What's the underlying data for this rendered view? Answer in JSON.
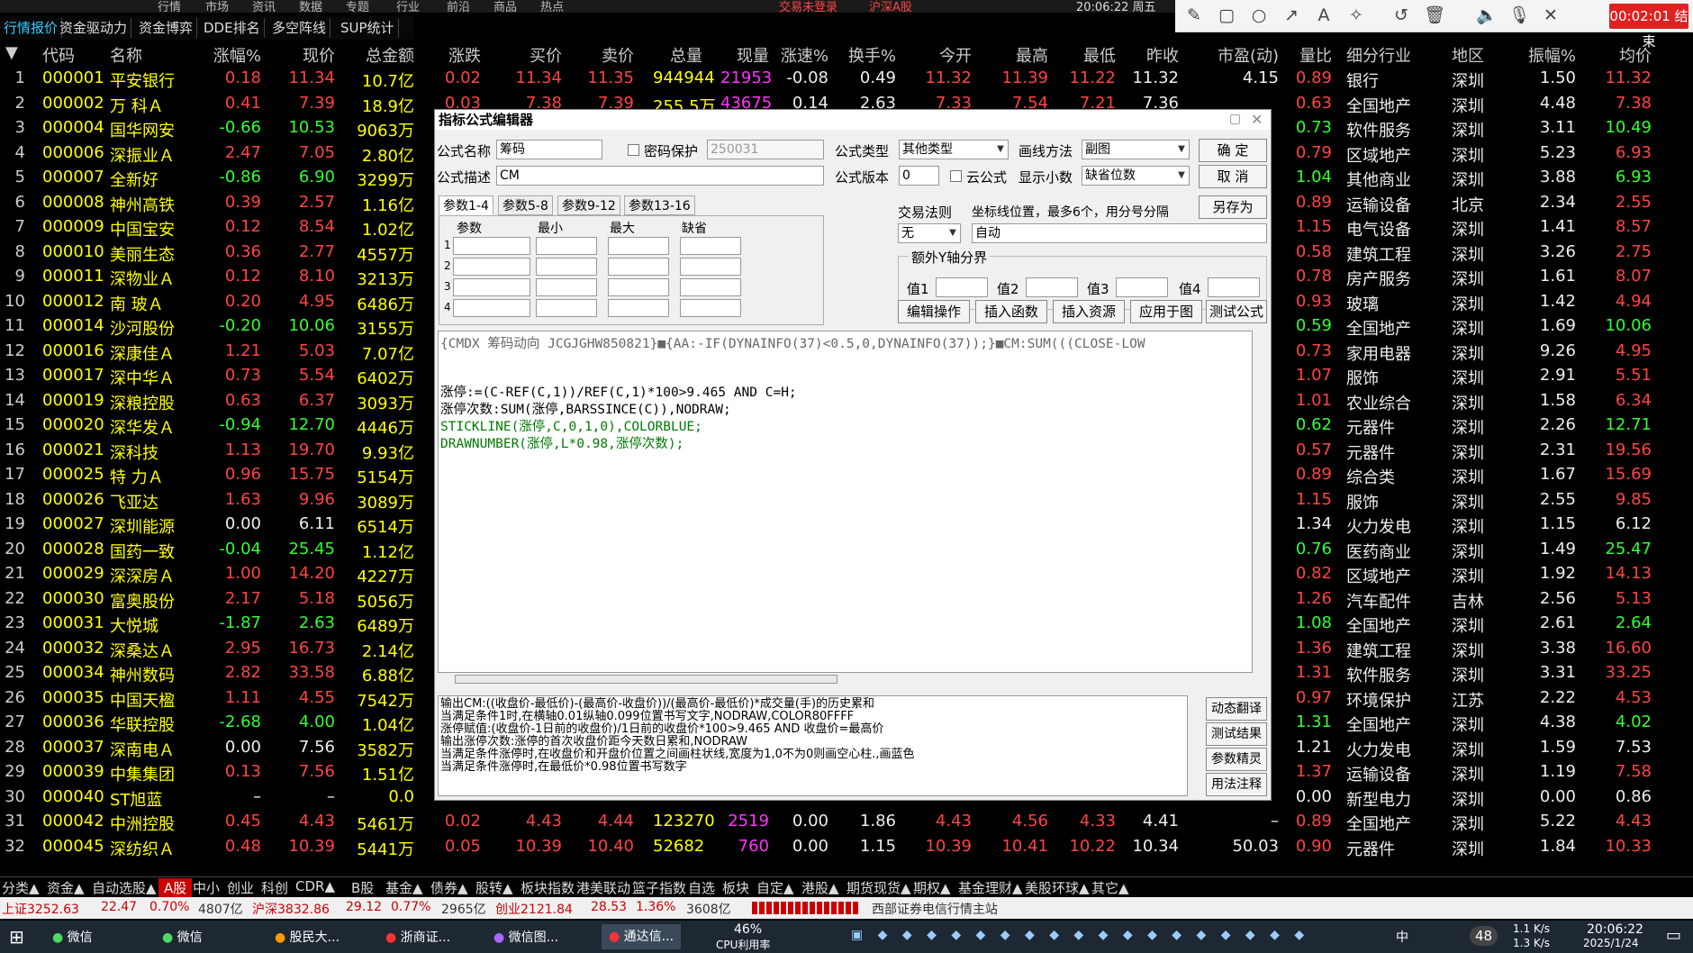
{
  "top_menu": [
    "行情",
    "市场",
    "资讯",
    "数据",
    "专题",
    "行业",
    "前沿",
    "商品",
    "热点"
  ],
  "top_status": {
    "trade": "交易未登录",
    "market": "沪深A股",
    "time": "20:06:22 周五"
  },
  "tabs": [
    "行情报价",
    "资金驱动力",
    "资金博弈",
    "DDE排名",
    "多空阵线",
    "SUP统计"
  ],
  "recording": {
    "timer": "00:02:01 结束"
  },
  "headers": [
    "代码",
    "名称",
    "涨幅%",
    "现价",
    "总金额",
    "涨跌",
    "买价",
    "卖价",
    "总量",
    "现量",
    "涨速%",
    "换手%",
    "今开",
    "最高",
    "最低",
    "昨收",
    "市盈(动)",
    "量比",
    "细分行业",
    "地区",
    "振幅%",
    "均价"
  ],
  "rows": [
    {
      "no": "1",
      "code": "000001",
      "name": "平安银行",
      "chg": "0.18",
      "price": "11.34",
      "amt": "10.7亿",
      "d": "0.02",
      "bid": "11.34",
      "ask": "11.35",
      "vol": "944944",
      "cur": "21953",
      "spd": "-0.08",
      "turn": "0.49",
      "open": "11.32",
      "high": "11.39",
      "low": "11.22",
      "prev": "11.32",
      "pe": "4.15",
      "lb": "0.89",
      "ind": "银行",
      "reg": "深圳",
      "amp": "1.50",
      "avg": "11.32"
    },
    {
      "no": "2",
      "code": "000002",
      "name": "万 科Ａ",
      "chg": "0.41",
      "price": "7.39",
      "amt": "18.9亿",
      "d": "0.03",
      "bid": "7.38",
      "ask": "7.39",
      "vol": "255.5万",
      "cur": "43675",
      "spd": "0.14",
      "turn": "2.63",
      "open": "7.33",
      "high": "7.54",
      "low": "7.21",
      "prev": "7.36",
      "pe": "",
      "lb": "0.63",
      "ind": "全国地产",
      "reg": "深圳",
      "amp": "4.48",
      "avg": "7.38"
    },
    {
      "no": "3",
      "code": "000004",
      "name": "国华网安",
      "chg": "-0.66",
      "price": "10.53",
      "amt": "9063万",
      "lb": "0.73",
      "ind": "软件服务",
      "reg": "深圳",
      "amp": "3.11",
      "avg": "10.49"
    },
    {
      "no": "4",
      "code": "000006",
      "name": "深振业Ａ",
      "chg": "2.47",
      "price": "7.05",
      "amt": "2.80亿",
      "lb": "0.79",
      "ind": "区域地产",
      "reg": "深圳",
      "amp": "5.23",
      "avg": "6.93"
    },
    {
      "no": "5",
      "code": "000007",
      "name": "全新好",
      "chg": "-0.86",
      "price": "6.90",
      "amt": "3299万",
      "lb": "1.04",
      "ind": "其他商业",
      "reg": "深圳",
      "amp": "3.88",
      "avg": "6.93"
    },
    {
      "no": "6",
      "code": "000008",
      "name": "神州高铁",
      "chg": "0.39",
      "price": "2.57",
      "amt": "1.16亿",
      "lb": "0.89",
      "ind": "运输设备",
      "reg": "北京",
      "amp": "2.34",
      "avg": "2.55"
    },
    {
      "no": "7",
      "code": "000009",
      "name": "中国宝安",
      "chg": "0.12",
      "price": "8.54",
      "amt": "1.02亿",
      "lb": "1.15",
      "ind": "电气设备",
      "reg": "深圳",
      "amp": "1.41",
      "avg": "8.57"
    },
    {
      "no": "8",
      "code": "000010",
      "name": "美丽生态",
      "chg": "0.36",
      "price": "2.77",
      "amt": "4557万",
      "lb": "0.58",
      "ind": "建筑工程",
      "reg": "深圳",
      "amp": "3.26",
      "avg": "2.75"
    },
    {
      "no": "9",
      "code": "000011",
      "name": "深物业Ａ",
      "chg": "0.12",
      "price": "8.10",
      "amt": "3213万",
      "lb": "0.78",
      "ind": "房产服务",
      "reg": "深圳",
      "amp": "1.61",
      "avg": "8.07"
    },
    {
      "no": "10",
      "code": "000012",
      "name": "南 玻Ａ",
      "chg": "0.20",
      "price": "4.95",
      "amt": "6486万",
      "lb": "0.93",
      "ind": "玻璃",
      "reg": "深圳",
      "amp": "1.42",
      "avg": "4.94"
    },
    {
      "no": "11",
      "code": "000014",
      "name": "沙河股份",
      "chg": "-0.20",
      "price": "10.06",
      "amt": "3155万",
      "lb": "0.59",
      "ind": "全国地产",
      "reg": "深圳",
      "amp": "1.69",
      "avg": "10.06"
    },
    {
      "no": "12",
      "code": "000016",
      "name": "深康佳Ａ",
      "chg": "1.21",
      "price": "5.03",
      "amt": "7.07亿",
      "lb": "0.73",
      "ind": "家用电器",
      "reg": "深圳",
      "amp": "9.26",
      "avg": "4.95"
    },
    {
      "no": "13",
      "code": "000017",
      "name": "深中华Ａ",
      "chg": "0.73",
      "price": "5.54",
      "amt": "6402万",
      "lb": "1.07",
      "ind": "服饰",
      "reg": "深圳",
      "amp": "2.91",
      "avg": "5.51"
    },
    {
      "no": "14",
      "code": "000019",
      "name": "深粮控股",
      "chg": "0.63",
      "price": "6.37",
      "amt": "3093万",
      "lb": "1.01",
      "ind": "农业综合",
      "reg": "深圳",
      "amp": "1.58",
      "avg": "6.34"
    },
    {
      "no": "15",
      "code": "000020",
      "name": "深华发Ａ",
      "chg": "-0.94",
      "price": "12.70",
      "amt": "4446万",
      "lb": "0.62",
      "ind": "元器件",
      "reg": "深圳",
      "amp": "2.26",
      "avg": "12.71"
    },
    {
      "no": "16",
      "code": "000021",
      "name": "深科技",
      "chg": "1.13",
      "price": "19.70",
      "amt": "9.93亿",
      "lb": "0.57",
      "ind": "元器件",
      "reg": "深圳",
      "amp": "2.31",
      "avg": "19.56"
    },
    {
      "no": "17",
      "code": "000025",
      "name": "特 力Ａ",
      "chg": "0.96",
      "price": "15.75",
      "amt": "5154万",
      "lb": "0.89",
      "ind": "综合类",
      "reg": "深圳",
      "amp": "1.67",
      "avg": "15.69"
    },
    {
      "no": "18",
      "code": "000026",
      "name": "飞亚达",
      "chg": "1.63",
      "price": "9.96",
      "amt": "3089万",
      "lb": "1.15",
      "ind": "服饰",
      "reg": "深圳",
      "amp": "2.55",
      "avg": "9.85"
    },
    {
      "no": "19",
      "code": "000027",
      "name": "深圳能源",
      "chg": "0.00",
      "price": "6.11",
      "amt": "6514万",
      "lb": "1.34",
      "ind": "火力发电",
      "reg": "深圳",
      "amp": "1.15",
      "avg": "6.12"
    },
    {
      "no": "20",
      "code": "000028",
      "name": "国药一致",
      "chg": "-0.04",
      "price": "25.45",
      "amt": "1.12亿",
      "lb": "0.76",
      "ind": "医药商业",
      "reg": "深圳",
      "amp": "1.49",
      "avg": "25.47"
    },
    {
      "no": "21",
      "code": "000029",
      "name": "深深房Ａ",
      "chg": "1.00",
      "price": "14.20",
      "amt": "4227万",
      "lb": "0.82",
      "ind": "区域地产",
      "reg": "深圳",
      "amp": "1.92",
      "avg": "14.13"
    },
    {
      "no": "22",
      "code": "000030",
      "name": "富奥股份",
      "chg": "2.17",
      "price": "5.18",
      "amt": "5056万",
      "lb": "1.26",
      "ind": "汽车配件",
      "reg": "吉林",
      "amp": "2.56",
      "avg": "5.13"
    },
    {
      "no": "23",
      "code": "000031",
      "name": "大悦城",
      "chg": "-1.87",
      "price": "2.63",
      "amt": "6489万",
      "lb": "1.08",
      "ind": "全国地产",
      "reg": "深圳",
      "amp": "2.61",
      "avg": "2.64"
    },
    {
      "no": "24",
      "code": "000032",
      "name": "深桑达Ａ",
      "chg": "2.95",
      "price": "16.73",
      "amt": "2.14亿",
      "lb": "1.36",
      "ind": "建筑工程",
      "reg": "深圳",
      "amp": "3.38",
      "avg": "16.60"
    },
    {
      "no": "25",
      "code": "000034",
      "name": "神州数码",
      "chg": "2.82",
      "price": "33.58",
      "amt": "6.88亿",
      "lb": "1.31",
      "ind": "软件服务",
      "reg": "深圳",
      "amp": "3.31",
      "avg": "33.25"
    },
    {
      "no": "26",
      "code": "000035",
      "name": "中国天楹",
      "chg": "1.11",
      "price": "4.55",
      "amt": "7542万",
      "lb": "0.97",
      "ind": "环境保护",
      "reg": "江苏",
      "amp": "2.22",
      "avg": "4.53"
    },
    {
      "no": "27",
      "code": "000036",
      "name": "华联控股",
      "chg": "-2.68",
      "price": "4.00",
      "amt": "1.04亿",
      "lb": "1.31",
      "ind": "全国地产",
      "reg": "深圳",
      "amp": "4.38",
      "avg": "4.02"
    },
    {
      "no": "28",
      "code": "000037",
      "name": "深南电Ａ",
      "chg": "0.00",
      "price": "7.56",
      "amt": "3582万",
      "lb": "1.21",
      "ind": "火力发电",
      "reg": "深圳",
      "amp": "1.59",
      "avg": "7.53"
    },
    {
      "no": "29",
      "code": "000039",
      "name": "中集集团",
      "chg": "0.13",
      "price": "7.56",
      "amt": "1.51亿",
      "lb": "1.37",
      "ind": "运输设备",
      "reg": "深圳",
      "amp": "1.19",
      "avg": "7.58"
    },
    {
      "no": "30",
      "code": "000040",
      "name": "ST旭蓝",
      "chg": "–",
      "price": "–",
      "amt": "0.0",
      "lb": "0.00",
      "ind": "新型电力",
      "reg": "深圳",
      "amp": "0.00",
      "avg": "0.86"
    },
    {
      "no": "31",
      "code": "000042",
      "name": "中洲控股",
      "chg": "0.45",
      "price": "4.43",
      "amt": "5461万",
      "d": "0.02",
      "bid": "4.43",
      "ask": "4.44",
      "vol": "123270",
      "cur": "2519",
      "spd": "0.00",
      "turn": "1.86",
      "open": "4.43",
      "high": "4.56",
      "low": "4.33",
      "prev": "4.41",
      "pe": "–",
      "lb": "0.89",
      "ind": "全国地产",
      "reg": "深圳",
      "amp": "5.22",
      "avg": "4.43"
    },
    {
      "no": "32",
      "code": "000045",
      "name": "深纺织Ａ",
      "chg": "0.48",
      "price": "10.39",
      "amt": "5441万",
      "d": "0.05",
      "bid": "10.39",
      "ask": "10.40",
      "vol": "52682",
      "cur": "760",
      "spd": "0.00",
      "turn": "1.15",
      "open": "10.39",
      "high": "10.41",
      "low": "10.22",
      "prev": "10.34",
      "pe": "50.03",
      "lb": "0.90",
      "ind": "元器件",
      "reg": "深圳",
      "amp": "1.84",
      "avg": "10.33"
    }
  ],
  "dialog": {
    "title": "指标公式编辑器",
    "name_label": "公式名称",
    "name_value": "筹码",
    "pwd_label": "密码保护",
    "pwd_value": "250031",
    "type_label": "公式类型",
    "type_value": "其他类型",
    "draw_label": "画线方法",
    "draw_value": "副图",
    "ok": "确  定",
    "cancel": "取  消",
    "saveas": "另存为",
    "desc_label": "公式描述",
    "desc_value": "CM",
    "ver_label": "公式版本",
    "ver_value": "0",
    "cloud_label": "云公式",
    "decimal_label": "显示小数",
    "decimal_value": "缺省位数",
    "param_tabs": [
      "参数1-4",
      "参数5-8",
      "参数9-12",
      "参数13-16"
    ],
    "param_headers": [
      "参数",
      "最小",
      "最大",
      "缺省"
    ],
    "param_rows": [
      "1",
      "2",
      "3",
      "4"
    ],
    "rule_label": "交易法则",
    "rule_value": "无",
    "coord_label": "坐标线位置，最多6个，用分号分隔",
    "coord_value": "自动",
    "yaxis_label": "额外Y轴分界",
    "yvals": [
      "值1",
      "值2",
      "值3",
      "值4"
    ],
    "actions": [
      "编辑操作",
      "插入函数",
      "插入资源",
      "应用于图",
      "测试公式"
    ],
    "code_line1": "{CMDX 筹码动向 JCGJGHW850821}■{AA:-IF(DYNAINFO(37)<0.5,0,DYNAINFO(37));}■CM:SUM(((CLOSE-LOW",
    "code_lines": [
      "涨停:=(C-REF(C,1))/REF(C,1)*100>9.465 AND C=H;",
      "涨停次数:SUM(涨停,BARSSINCE(C)),NODRAW;",
      "STICKLINE(涨停,C,0,1,0),COLORBLUE;",
      "DRAWNUMBER(涨停,L*0.98,涨停次数);"
    ],
    "output_lines": [
      "输出CM:((收盘价-最低价)-(最高价-收盘价))/(最高价-最低价)*成交量(手)的历史累和",
      "当满足条件1时,在横轴0.01纵轴0.099位置书写文字,NODRAW,COLOR80FFFF",
      "涨停赋值:(收盘价-1日前的收盘价)/1日前的收盘价*100>9.465 AND 收盘价=最高价",
      "输出涨停次数:涨停的首次收盘价距今天数日累和,NODRAW",
      "当满足条件涨停时,在收盘价和开盘价位置之间画柱状线,宽度为1,0不为0则画空心柱.,画蓝色",
      "当满足条件涨停时,在最低价*0.98位置书写数字"
    ],
    "side_buttons": [
      "动态翻译",
      "测试结果",
      "参数精灵",
      "用法注释"
    ]
  },
  "cat_tabs": [
    "分类▲",
    "资金▲",
    "自动选股▲",
    "A股",
    "中小",
    "创业",
    "科创",
    "CDR▲",
    "B股",
    "基金▲",
    "债券▲",
    "股转▲",
    "板块指数",
    "港美联动",
    "篮子指数",
    "自选",
    "板块",
    "自定▲",
    "港股▲",
    "期货现货▲",
    "期权▲",
    "基金理财▲",
    "美股环球▲",
    "其它▲"
  ],
  "status": {
    "sh": "上证3252.63",
    "sh_d": "22.47",
    "sh_p": "0.70%",
    "sh_amt": "4807亿",
    "hs": "沪深3832.86",
    "hs_d": "29.12",
    "hs_p": "0.77%",
    "hs_amt": "2965亿",
    "cy": "创业2121.84",
    "cy_d": "28.53",
    "cy_p": "1.36%",
    "cy_amt": "3608亿",
    "server": "西部证券电信行情主站"
  },
  "taskbar": {
    "apps": [
      "微信",
      "微信",
      "股民大...",
      "浙商证...",
      "微信图...",
      "通达信..."
    ],
    "cpu": "46%",
    "cpu_label": "CPU利用率",
    "clock_time": "20:06:22",
    "clock_date": "2025/1/24",
    "input": "中",
    "badge": "48",
    "net_up": "1.1 K/s",
    "net_down": "1.3 K/s"
  }
}
